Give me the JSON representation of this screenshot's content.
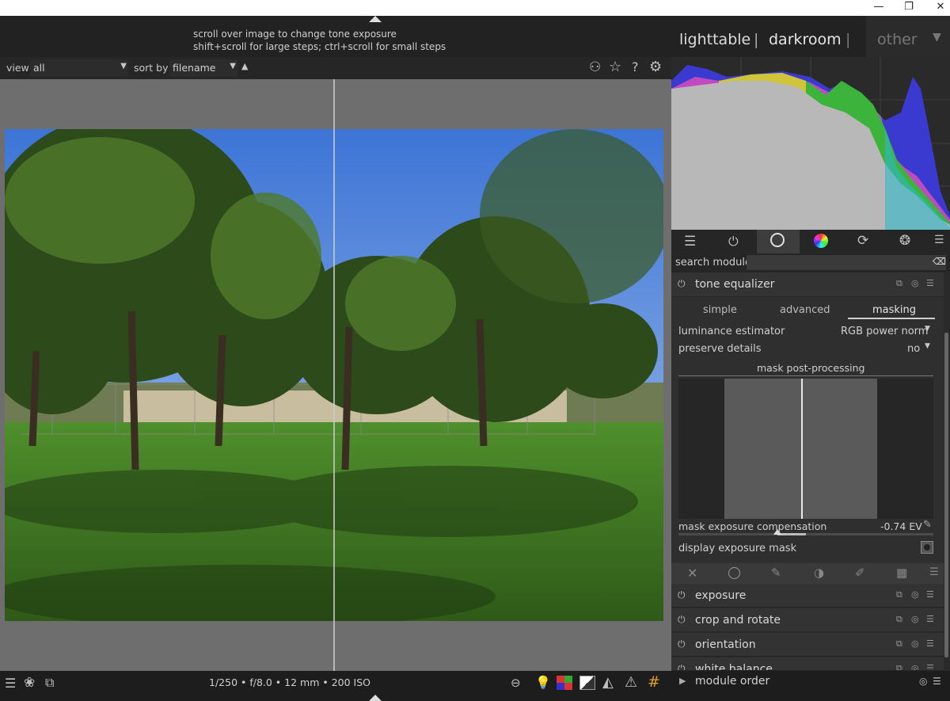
{
  "tooltip": {
    "line1": "scroll over image to change tone exposure",
    "line2": "shift+scroll for large steps; ctrl+scroll for small steps"
  },
  "window_buttons": {
    "minimize": "—",
    "restore": "❐",
    "close": "✕"
  },
  "views": {
    "lighttable": "lighttable",
    "sep1": "|",
    "darkroom": "darkroom",
    "sep2": "|",
    "other": "other"
  },
  "filter": {
    "view_label": "view",
    "view_value": "all",
    "sort_label": "sort by",
    "sort_value": "filename"
  },
  "right_panel": {
    "search_label": "search module",
    "active_module": {
      "name": "tone equalizer",
      "tabs": [
        "simple",
        "advanced",
        "masking"
      ],
      "active_tab": "masking",
      "luminance_estimator_label": "luminance estimator",
      "luminance_estimator_value": "RGB power norm",
      "preserve_details_label": "preserve details",
      "preserve_details_value": "no",
      "section_title": "mask post-processing",
      "exposure_comp_label": "mask exposure compensation",
      "exposure_comp_value": "-0.74 EV",
      "display_mask_label": "display exposure mask"
    },
    "modules": [
      "exposure",
      "crop and rotate",
      "orientation",
      "white balance"
    ],
    "module_order_label": "module order"
  },
  "bottom": {
    "info": "1/250 • f/8.0 • 12 mm • 200 ISO"
  },
  "colors": {
    "background": "#1f1f1f",
    "panel": "#2a2a2a",
    "active_tab_underline": "#d0d0d0",
    "mask_gray": "#5a5a5a"
  }
}
